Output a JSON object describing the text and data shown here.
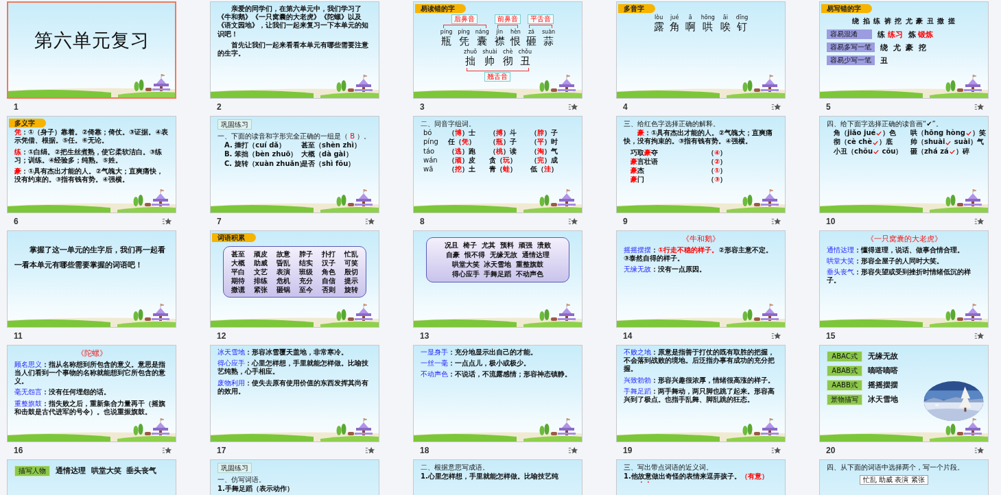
{
  "slides": [
    {
      "number": "1",
      "selected": true,
      "animated": false,
      "blocks": [
        {
          "kind": "title",
          "text": "第六单元复习"
        }
      ]
    },
    {
      "number": "2",
      "selected": false,
      "animated": false,
      "blocks": [
        {
          "kind": "indented",
          "text": "亲爱的同学们，在第六单元中，我们学习了《牛和鹅》《一只窝囊的大老虎》《陀螺》以及《语文园地》，让我们一起来复习一下本单元的知识吧！"
        },
        {
          "kind": "indented",
          "text": "首先让我们一起来看看本单元有哪些需要注意的生字。"
        }
      ]
    },
    {
      "number": "3",
      "selected": false,
      "animated": true,
      "blocks": [
        {
          "kind": "ribbon",
          "text": "易读错的字"
        },
        {
          "kind": "pinyin",
          "groups": [
            {
              "label": "后鼻音",
              "items": [
                {
                  "py": "píng",
                  "ch": "瓶"
                },
                {
                  "py": "píng",
                  "ch": "凭"
                },
                {
                  "py": "náng",
                  "ch": "囊"
                }
              ]
            },
            {
              "label": "前鼻音",
              "items": [
                {
                  "py": "jìn",
                  "ch": "襟"
                },
                {
                  "py": "hèn",
                  "ch": "恨"
                }
              ]
            },
            {
              "label": "平舌音",
              "items": [
                {
                  "py": "zá",
                  "ch": "砸"
                },
                {
                  "py": "suàn",
                  "ch": "蒜"
                }
              ]
            }
          ]
        },
        {
          "kind": "pinyin",
          "groups": [
            {
              "bottom_label": "翘舌音",
              "items": [
                {
                  "py": "zhuō",
                  "ch": "拙"
                },
                {
                  "py": "shuài",
                  "ch": "帅"
                },
                {
                  "py": "chè",
                  "ch": "彻"
                },
                {
                  "py": "chǒu",
                  "ch": "丑"
                }
              ]
            }
          ]
        }
      ]
    },
    {
      "number": "4",
      "selected": false,
      "animated": true,
      "blocks": [
        {
          "kind": "ribbon",
          "text": "多音字"
        },
        {
          "kind": "pinyin",
          "groups": [
            {
              "items": [
                {
                  "py": "lòu",
                  "ch": "露"
                },
                {
                  "py": "jué",
                  "ch": "角"
                },
                {
                  "py": "ā",
                  "ch": "啊"
                },
                {
                  "py": "hōng",
                  "ch": "哄"
                },
                {
                  "py": "āi",
                  "ch": "唉"
                },
                {
                  "py": "dīng",
                  "ch": "钉"
                }
              ]
            }
          ]
        }
      ]
    },
    {
      "number": "5",
      "selected": false,
      "animated": true,
      "blocks": [
        {
          "kind": "ribbon",
          "text": "易写错的字"
        },
        {
          "kind": "char-line",
          "text": "绕 掐 练 裤 挖 尤 豪 丑 撒 搓"
        },
        {
          "kind": "tag-row",
          "tag": "容易混淆",
          "runs": [
            {
              "text": "练 "
            },
            {
              "text": "练习",
              "kind": "red"
            },
            {
              "text": "  炼 "
            },
            {
              "text": "锻炼",
              "kind": "red"
            }
          ]
        },
        {
          "kind": "tag-row",
          "tag": "容易多写一笔",
          "text": "绕  尤  豪  挖"
        },
        {
          "kind": "tag-row",
          "tag": "容易少写一笔",
          "text": "丑"
        }
      ]
    },
    {
      "number": "6",
      "selected": false,
      "animated": true,
      "blocks": [
        {
          "kind": "ribbon",
          "text": "多义字"
        },
        {
          "kind": "para",
          "runs": [
            {
              "text": "凭",
              "kind": "red"
            },
            {
              "text": "：①（身子）靠着。②倚靠；倚仗。③证据。④表示凭借、根据。⑤任。⑥无论。"
            }
          ]
        },
        {
          "kind": "para",
          "runs": [
            {
              "text": "练",
              "kind": "red"
            },
            {
              "text": "：①白绢。②把生丝煮熟，使它柔软洁白。③练习；训练。④经验多；纯熟。⑤姓。"
            }
          ]
        },
        {
          "kind": "para",
          "runs": [
            {
              "text": "豪",
              "kind": "red"
            },
            {
              "text": "：①具有杰出才能的人。②气魄大；直爽痛快，没有约束的。③指有钱有势。④强横。"
            }
          ]
        }
      ]
    },
    {
      "number": "7",
      "selected": false,
      "animated": true,
      "blocks": [
        {
          "kind": "chip",
          "text": "巩固练习"
        },
        {
          "kind": "heading",
          "runs": [
            {
              "text": "一、下面的读音和字形完全正确的一组是（ "
            },
            {
              "text": "B",
              "kind": "red"
            },
            {
              "text": " ）。"
            }
          ]
        },
        {
          "kind": "pair",
          "left": [
            {
              "text": "A. 捶打（cuí dǎ）"
            }
          ],
          "right": [
            {
              "text": "甚至（shèn zhì）"
            }
          ]
        },
        {
          "kind": "pair",
          "left": [
            {
              "text": "B. 笨拙（bèn zhuō）"
            }
          ],
          "right": [
            {
              "text": "大概（dà gài）"
            }
          ]
        },
        {
          "kind": "pair",
          "left": [
            {
              "text": "C. 旋转（xuàn zhuǎn）"
            }
          ],
          "right": [
            {
              "text": "是否（shì fǒu）"
            }
          ]
        }
      ]
    },
    {
      "number": "8",
      "selected": false,
      "animated": true,
      "blocks": [
        {
          "kind": "heading",
          "text": "二、同音字组词。"
        },
        {
          "kind": "row",
          "cells": [
            [
              {
                "text": "bó"
              }
            ],
            [
              {
                "text": "（"
              },
              {
                "text": "博",
                "kind": "red"
              },
              {
                "text": "）士"
              }
            ],
            [
              {
                "text": "（"
              },
              {
                "text": "搏",
                "kind": "red"
              },
              {
                "text": "）斗"
              }
            ],
            [
              {
                "text": "（"
              },
              {
                "text": "脖",
                "kind": "red"
              },
              {
                "text": "）子"
              }
            ]
          ]
        },
        {
          "kind": "row",
          "cells": [
            [
              {
                "text": "píng"
              }
            ],
            [
              {
                "text": "任（"
              },
              {
                "text": "凭",
                "kind": "red"
              },
              {
                "text": "）"
              }
            ],
            [
              {
                "text": "（"
              },
              {
                "text": "瓶",
                "kind": "red"
              },
              {
                "text": "）子"
              }
            ],
            [
              {
                "text": "（"
              },
              {
                "text": "平",
                "kind": "red"
              },
              {
                "text": "）时"
              }
            ]
          ]
        },
        {
          "kind": "row",
          "cells": [
            [
              {
                "text": "táo"
              }
            ],
            [
              {
                "text": "（"
              },
              {
                "text": "逃",
                "kind": "red"
              },
              {
                "text": "）跑"
              }
            ],
            [
              {
                "text": "（"
              },
              {
                "text": "桃",
                "kind": "red"
              },
              {
                "text": "）读"
              }
            ],
            [
              {
                "text": "（"
              },
              {
                "text": "淘",
                "kind": "red"
              },
              {
                "text": "）气"
              }
            ]
          ]
        },
        {
          "kind": "row",
          "cells": [
            [
              {
                "text": "wán"
              }
            ],
            [
              {
                "text": "（"
              },
              {
                "text": "顽",
                "kind": "red"
              },
              {
                "text": "）皮"
              }
            ],
            [
              {
                "text": "贪（"
              },
              {
                "text": "玩",
                "kind": "red"
              },
              {
                "text": "）"
              }
            ],
            [
              {
                "text": "（"
              },
              {
                "text": "完",
                "kind": "red"
              },
              {
                "text": "）成"
              }
            ]
          ]
        },
        {
          "kind": "row",
          "cells": [
            [
              {
                "text": "wā"
              }
            ],
            [
              {
                "text": "（"
              },
              {
                "text": "挖",
                "kind": "red"
              },
              {
                "text": "）土"
              }
            ],
            [
              {
                "text": "青（"
              },
              {
                "text": "蛙",
                "kind": "red"
              },
              {
                "text": "）"
              }
            ],
            [
              {
                "text": "低（"
              },
              {
                "text": "洼",
                "kind": "red"
              },
              {
                "text": "）"
              }
            ]
          ]
        }
      ]
    },
    {
      "number": "9",
      "selected": false,
      "animated": true,
      "blocks": [
        {
          "kind": "heading",
          "text": "三、给红色字选择正确的解释。"
        },
        {
          "kind": "indented",
          "runs": [
            {
              "text": "豪",
              "kind": "red"
            },
            {
              "text": "：①具有杰出才能的人。②气魄大；直爽痛快，没有拘束的。③指有钱有势。④强横。"
            }
          ]
        },
        {
          "kind": "pair",
          "left": [
            {
              "text": "巧取"
            },
            {
              "text": "豪",
              "kind": "red"
            },
            {
              "text": "夺"
            }
          ],
          "right": [
            {
              "text": "（"
            },
            {
              "text": "④",
              "kind": "red"
            },
            {
              "text": "）"
            }
          ]
        },
        {
          "kind": "pair",
          "left": [
            {
              "text": "豪",
              "kind": "red"
            },
            {
              "text": "言壮语"
            }
          ],
          "right": [
            {
              "text": "（"
            },
            {
              "text": "②",
              "kind": "red"
            },
            {
              "text": "）"
            }
          ]
        },
        {
          "kind": "pair",
          "left": [
            {
              "text": "豪",
              "kind": "red"
            },
            {
              "text": "杰"
            }
          ],
          "right": [
            {
              "text": "（"
            },
            {
              "text": "①",
              "kind": "red"
            },
            {
              "text": "）"
            }
          ]
        },
        {
          "kind": "pair",
          "left": [
            {
              "text": "豪",
              "kind": "red"
            },
            {
              "text": "门"
            }
          ],
          "right": [
            {
              "text": "（"
            },
            {
              "text": "③",
              "kind": "red"
            },
            {
              "text": "）"
            }
          ]
        }
      ]
    },
    {
      "number": "10",
      "selected": false,
      "animated": true,
      "blocks": [
        {
          "kind": "heading",
          "text": "四、给下面字选择正确的读音画“✔”。"
        },
        {
          "kind": "pair",
          "left": [
            {
              "text": "角（jiǎo jué"
            },
            {
              "kind": "tick"
            },
            {
              "text": "）色"
            }
          ],
          "right": [
            {
              "text": "哄（hōng hòng"
            },
            {
              "kind": "tick"
            },
            {
              "text": "）笑"
            }
          ]
        },
        {
          "kind": "pair",
          "left": [
            {
              "text": "彻（cè chè"
            },
            {
              "kind": "tick"
            },
            {
              "text": "）底"
            }
          ],
          "right": [
            {
              "text": "帅（shuài"
            },
            {
              "kind": "tick"
            },
            {
              "text": " suài）气"
            }
          ]
        },
        {
          "kind": "pair",
          "left": [
            {
              "text": "小丑（chǒu"
            },
            {
              "kind": "tick"
            },
            {
              "text": " cǒu）"
            }
          ],
          "right": [
            {
              "text": "砸（zhá zá"
            },
            {
              "kind": "tick"
            },
            {
              "text": "）碎"
            }
          ]
        }
      ]
    },
    {
      "number": "11",
      "selected": false,
      "animated": false,
      "blocks": [
        {
          "kind": "lead",
          "text": "掌握了这一单元的生字后，我们再一起看一看本单元有哪些需要掌握的词语吧！"
        }
      ]
    },
    {
      "number": "12",
      "selected": false,
      "animated": false,
      "blocks": [
        {
          "kind": "ribbon",
          "text": "词语积累"
        },
        {
          "kind": "words",
          "rows": [
            [
              "甚至",
              "顽皮",
              "故意",
              "脖子",
              "扑打",
              "忙乱"
            ],
            [
              "大概",
              "助威",
              "昏乱",
              "结实",
              "汉子",
              "可笑"
            ],
            [
              "平白",
              "文艺",
              "表演",
              "班级",
              "角色",
              "殷切"
            ],
            [
              "期待",
              "排练",
              "危机",
              "充分",
              "自信",
              "提示"
            ],
            [
              "撒谎",
              "紧张",
              "砸锅",
              "至今",
              "否则",
              "旋转"
            ]
          ]
        }
      ]
    },
    {
      "number": "13",
      "selected": false,
      "animated": false,
      "blocks": [
        {
          "kind": "word-lines",
          "lines": [
            "况且  椅子  尤其  预料  顽强  溃败",
            "自豪  恨不得  无缘无故  通情达理",
            "哄堂大笑  冰天雪地  重整旗鼓",
            "得心应手  手舞足蹈  不动声色"
          ]
        }
      ]
    },
    {
      "number": "14",
      "selected": false,
      "animated": true,
      "blocks": [
        {
          "kind": "book-title",
          "text": "《牛和鹅》"
        },
        {
          "kind": "para",
          "runs": [
            {
              "text": "摇摇摆摆",
              "kind": "blue"
            },
            {
              "text": "："
            },
            {
              "text": "①行走不稳的样子。",
              "kind": "red"
            },
            {
              "text": "②形容主意不定。③泰然自得的样子。"
            }
          ]
        },
        {
          "kind": "para",
          "runs": [
            {
              "text": "无缘无故",
              "kind": "blue"
            },
            {
              "text": "：没有一点原因。"
            }
          ]
        }
      ]
    },
    {
      "number": "15",
      "selected": false,
      "animated": true,
      "blocks": [
        {
          "kind": "book-title",
          "text": "《一只窝囊的大老虎》"
        },
        {
          "kind": "para",
          "runs": [
            {
              "text": "通情达理",
              "kind": "blue"
            },
            {
              "text": "：懂得道理，说话、做事合情合理。"
            }
          ]
        },
        {
          "kind": "para",
          "runs": [
            {
              "text": "哄堂大笑",
              "kind": "blue"
            },
            {
              "text": "：形容全屋子的人同时大笑。"
            }
          ]
        },
        {
          "kind": "para",
          "runs": [
            {
              "text": "垂头丧气",
              "kind": "blue"
            },
            {
              "text": "：形容失望或受到挫折时情绪低沉的样子。"
            }
          ]
        }
      ]
    },
    {
      "number": "16",
      "selected": false,
      "animated": true,
      "blocks": [
        {
          "kind": "book-title",
          "text": "《陀螺》"
        },
        {
          "kind": "para",
          "runs": [
            {
              "text": "顾名思义",
              "kind": "blue"
            },
            {
              "text": "：指从名称想到所包含的意义。意思是指当人们看到一个事物的名称就能想到它所包含的意义。"
            }
          ]
        },
        {
          "kind": "para",
          "runs": [
            {
              "text": "毫无怨言",
              "kind": "blue"
            },
            {
              "text": "：没有任何埋怨的话。"
            }
          ]
        },
        {
          "kind": "para",
          "runs": [
            {
              "text": "重整旗鼓",
              "kind": "blue"
            },
            {
              "text": "：指失败之后，重新集合力量再干（摇旗和击鼓是古代进军的号令）。也说重振旗鼓。"
            }
          ]
        }
      ]
    },
    {
      "number": "17",
      "selected": false,
      "animated": true,
      "blocks": [
        {
          "kind": "para",
          "runs": [
            {
              "text": "冰天雪地",
              "kind": "blue"
            },
            {
              "text": "：形容冰雪覆天盖地，非常寒冷。"
            }
          ]
        },
        {
          "kind": "para",
          "runs": [
            {
              "text": "得心应手",
              "kind": "blue"
            },
            {
              "text": "：心里怎样想，手里就能怎样做。比喻技艺纯熟，心手相应。"
            }
          ]
        },
        {
          "kind": "para",
          "runs": [
            {
              "text": "废物利用",
              "kind": "blue"
            },
            {
              "text": "：使失去原有使用价值的东西发挥其尚有的效用。"
            }
          ]
        }
      ]
    },
    {
      "number": "18",
      "selected": false,
      "animated": true,
      "blocks": [
        {
          "kind": "para",
          "runs": [
            {
              "text": "一显身手",
              "kind": "blue"
            },
            {
              "text": "：充分地显示出自己的才能。"
            }
          ]
        },
        {
          "kind": "para",
          "runs": [
            {
              "text": "一丝一毫",
              "kind": "blue"
            },
            {
              "text": "：一点点儿，极小或极少。"
            }
          ]
        },
        {
          "kind": "para",
          "runs": [
            {
              "text": "不动声色",
              "kind": "blue"
            },
            {
              "text": "：不说话，不流露感情；形容神态镇静。"
            }
          ]
        }
      ]
    },
    {
      "number": "19",
      "selected": false,
      "animated": true,
      "blocks": [
        {
          "kind": "para",
          "runs": [
            {
              "text": "不败之地",
              "kind": "blue"
            },
            {
              "text": "：原意是指善于打仗的既有取胜的把握，不会落到战败的境地。后泛指办事有成功的充分把握。"
            }
          ]
        },
        {
          "kind": "para",
          "runs": [
            {
              "text": "兴致勃勃",
              "kind": "blue"
            },
            {
              "text": "：形容兴趣很浓厚，情绪很高涨的样子。"
            }
          ]
        },
        {
          "kind": "para",
          "runs": [
            {
              "text": "手舞足蹈",
              "kind": "blue"
            },
            {
              "text": "：两手舞动，两只脚也跳了起来。形容高兴到了极点。也指手乱舞、脚乱跳的狂态。"
            }
          ]
        }
      ]
    },
    {
      "number": "20",
      "selected": false,
      "animated": true,
      "blocks": [
        {
          "kind": "badge-row",
          "tag": "ABAC式",
          "text": "无缘无故"
        },
        {
          "kind": "badge-row",
          "tag": "ABAB式",
          "text": "嘀嗒嘀嗒"
        },
        {
          "kind": "badge-row",
          "tag": "AABB式",
          "text": "摇摇摆摆"
        },
        {
          "kind": "badge-row",
          "tag": "景物描写",
          "text": "冰天雪地"
        },
        {
          "kind": "picture"
        }
      ]
    },
    {
      "selected": false,
      "blocks": [
        {
          "kind": "badge-row",
          "tag": "描写人物",
          "text": "通情达理  哄堂大笑  垂头丧气"
        }
      ]
    },
    {
      "selected": false,
      "blocks": [
        {
          "kind": "chip",
          "text": "巩固练习"
        },
        {
          "kind": "heading",
          "text": "一、仿写词语。"
        },
        {
          "kind": "para",
          "text": "1.手舞足蹈（表示动作）"
        }
      ]
    },
    {
      "selected": false,
      "blocks": [
        {
          "kind": "heading",
          "text": "二、根据意思写成语。"
        },
        {
          "kind": "para",
          "text": "1.心里怎样想，手里就能怎样做。比喻技艺纯"
        }
      ]
    },
    {
      "selected": false,
      "blocks": [
        {
          "kind": "heading",
          "text": "三、写出带点词语的近义词。"
        },
        {
          "kind": "para",
          "runs": [
            {
              "text": "1.他"
            },
            {
              "text": "故意",
              "kind": "dotted"
            },
            {
              "text": "做出奇怪的表情来逗弄孩子。"
            },
            {
              "text": "（有意）",
              "kind": "red"
            }
          ]
        }
      ]
    },
    {
      "selected": false,
      "blocks": [
        {
          "kind": "heading",
          "text": "四、从下面的词语中选择两个，写一个片段。"
        },
        {
          "kind": "plain-words",
          "text": "忙乱  助威  表演  紧张"
        }
      ]
    }
  ]
}
